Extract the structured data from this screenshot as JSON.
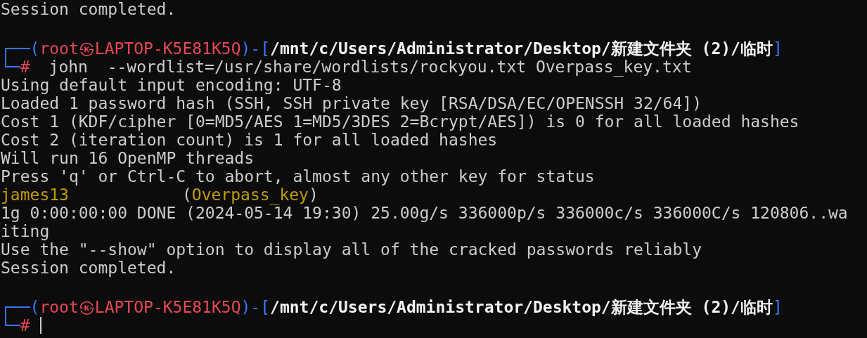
{
  "terminal": {
    "lines": [
      {
        "kind": "output",
        "text": "Session completed."
      },
      {
        "kind": "blank"
      },
      {
        "kind": "prompt",
        "corner": "┌──",
        "open": "(",
        "user": "root",
        "at": "㉿",
        "host": "LAPTOP-K5E81K5Q",
        "close": ")-[",
        "path": "/mnt/c/Users/Administrator/Desktop/新建文件夹 (2)/临时",
        "end": "]"
      },
      {
        "kind": "command",
        "corner": "└─",
        "sigil": "#",
        "command": "john  --wordlist=/usr/share/wordlists/rockyou.txt Overpass_key.txt",
        "cursor": false
      },
      {
        "kind": "output",
        "text": "Using default input encoding: UTF-8"
      },
      {
        "kind": "output",
        "text": "Loaded 1 password hash (SSH, SSH private key [RSA/DSA/EC/OPENSSH 32/64])"
      },
      {
        "kind": "output",
        "text": "Cost 1 (KDF/cipher [0=MD5/AES 1=MD5/3DES 2=Bcrypt/AES]) is 0 for all loaded hashes"
      },
      {
        "kind": "output",
        "text": "Cost 2 (iteration count) is 1 for all loaded hashes"
      },
      {
        "kind": "output",
        "text": "Will run 16 OpenMP threads"
      },
      {
        "kind": "output",
        "text": "Press 'q' or Ctrl-C to abort, almost any other key for status"
      },
      {
        "kind": "result",
        "password": "james13",
        "open": "(",
        "name": "Overpass_key",
        "close": ")"
      },
      {
        "kind": "output",
        "text": "1g 0:00:00:00 DONE (2024-05-14 19:30) 25.00g/s 336000p/s 336000c/s 336000C/s 120806..wa"
      },
      {
        "kind": "output",
        "text": "iting"
      },
      {
        "kind": "output",
        "text": "Use the \"--show\" option to display all of the cracked passwords reliably"
      },
      {
        "kind": "output",
        "text": "Session completed."
      },
      {
        "kind": "blank"
      },
      {
        "kind": "prompt",
        "corner": "┌──",
        "open": "(",
        "user": "root",
        "at": "㉿",
        "host": "LAPTOP-K5E81K5Q",
        "close": ")-[",
        "path": "/mnt/c/Users/Administrator/Desktop/新建文件夹 (2)/临时",
        "end": "]"
      },
      {
        "kind": "command",
        "corner": "└─",
        "sigil": "#",
        "cursor": true
      }
    ]
  }
}
